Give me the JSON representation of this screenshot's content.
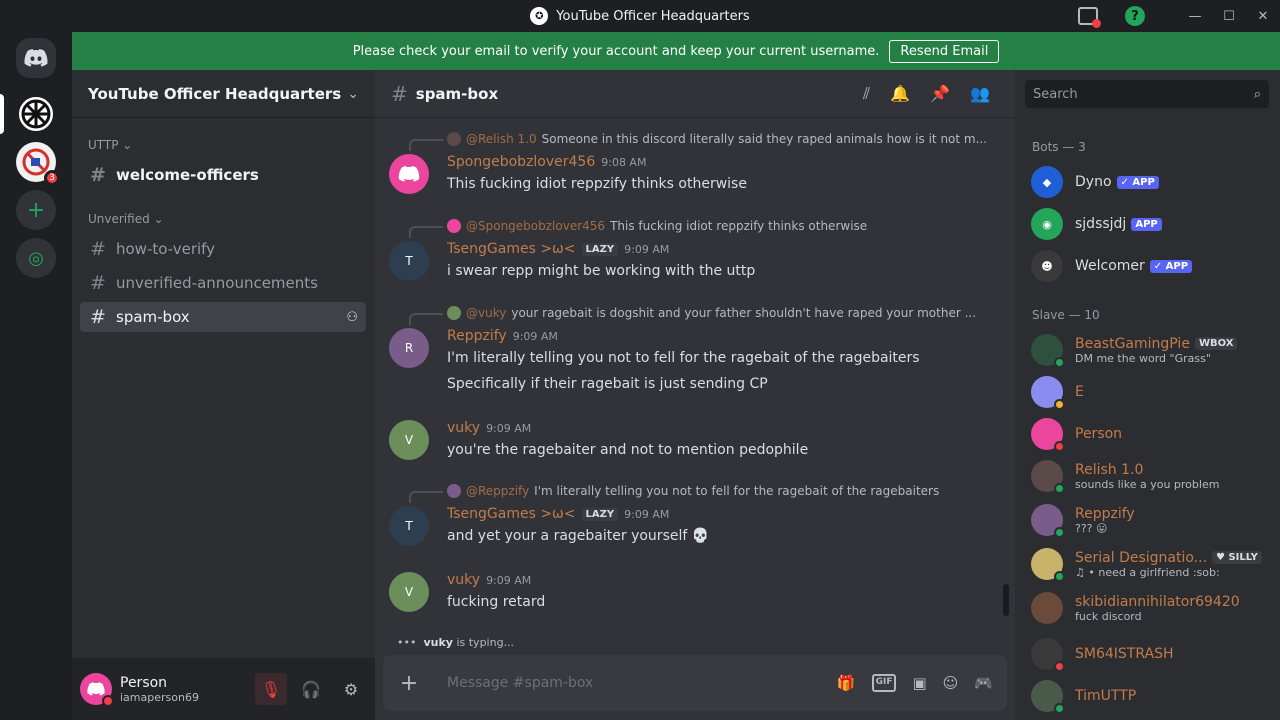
{
  "window": {
    "title": "YouTube Officer Headquarters",
    "controls": [
      "—",
      "☐",
      "✕"
    ]
  },
  "banner": {
    "text": "Please check your email to verify your account and keep your current username.",
    "button": "Resend Email"
  },
  "rail": {
    "badge_count": "3"
  },
  "server": {
    "name": "YouTube Officer Headquarters",
    "categories": [
      {
        "name": "UTTP ⌄",
        "channels": [
          "welcome-officers"
        ]
      },
      {
        "name": "Unverified ⌄",
        "channels": [
          "how-to-verify",
          "unverified-announcements",
          "spam-box"
        ]
      }
    ]
  },
  "user_panel": {
    "display_name": "Person",
    "username": "iamaperson69"
  },
  "chat": {
    "channel": "spam-box",
    "messages": [
      {
        "reply_name": "@Relish 1.0",
        "reply_text": "Someone in this discord literally said they raped animals how is it not m...",
        "author": "Spongebobzlover456",
        "tag": "",
        "time": "9:08 AM",
        "lines": [
          "This fucking idiot reppzify thinks otherwise"
        ],
        "avatar_color": "#eb459e"
      },
      {
        "reply_name": "@Spongebobzlover456",
        "reply_text": "This fucking idiot reppzify thinks otherwise",
        "author": "TsengGames >ω<",
        "tag": "LAZY",
        "time": "9:09 AM",
        "lines": [
          "i swear repp might be working with the uttp"
        ],
        "avatar_color": "#2c3e50"
      },
      {
        "reply_name": "@vuky",
        "reply_text": "your ragebait is dogshit and your father shouldn't have raped your mother ...",
        "author": "Reppzify",
        "tag": "",
        "time": "9:09 AM",
        "lines": [
          "I'm literally telling you not to fell for the ragebait of the ragebaiters",
          "Specifically if their ragebait is just sending CP"
        ],
        "avatar_color": "#7a5c8a"
      },
      {
        "reply_name": "",
        "reply_text": "",
        "author": "vuky",
        "tag": "",
        "time": "9:09 AM",
        "lines": [
          "you're the ragebaiter and not to mention pedophile"
        ],
        "avatar_color": "#6b8e5a"
      },
      {
        "reply_name": "@Reppzify",
        "reply_text": "I'm literally telling you not to fell for the ragebait of the ragebaiters",
        "author": "TsengGames >ω<",
        "tag": "LAZY",
        "time": "9:09 AM",
        "lines": [
          "and yet your a ragebaiter yourself 💀"
        ],
        "avatar_color": "#2c3e50"
      },
      {
        "reply_name": "",
        "reply_text": "",
        "author": "vuky",
        "tag": "",
        "time": "9:09 AM",
        "lines": [
          "fucking retard"
        ],
        "avatar_color": "#6b8e5a"
      }
    ],
    "typing_user": "vuky",
    "typing_suffix": " is typing...",
    "composer_placeholder": "Message #spam-box"
  },
  "members": {
    "search_placeholder": "Search",
    "groups": [
      {
        "label": "Bots — 3",
        "items": [
          {
            "name": "Dyno",
            "tag": "✓ APP",
            "sub": "",
            "color": "#3b82f6",
            "status": ""
          },
          {
            "name": "sjdssjdj",
            "tag": "APP",
            "sub": "",
            "color": "#23a55a",
            "status": ""
          },
          {
            "name": "Welcomer",
            "tag": "✓ APP",
            "sub": "",
            "color": "#3a3a3a",
            "status": ""
          }
        ]
      },
      {
        "label": "Slave — 10",
        "items": [
          {
            "name": "BeastGamingPie",
            "tag": "WBOX",
            "sub": "DM me the word \"Grass\"",
            "color": "#2f4f3f",
            "status": "#23a55a"
          },
          {
            "name": "E",
            "tag": "",
            "sub": "",
            "color": "#8b8cf0",
            "status": "#f0b232"
          },
          {
            "name": "Person",
            "tag": "",
            "sub": "",
            "color": "#eb459e",
            "status": "#f23f43"
          },
          {
            "name": "Relish 1.0",
            "tag": "",
            "sub": "sounds like a you problem",
            "color": "#5a4a4a",
            "status": "#23a55a"
          },
          {
            "name": "Reppzify",
            "tag": "",
            "sub": "??? 😛",
            "color": "#7a5c8a",
            "status": "#23a55a"
          },
          {
            "name": "Serial Designatio...",
            "tag": "♥ SILLY",
            "sub": "♫ • need a girlfriend :sob:",
            "color": "#c9b36b",
            "status": "#23a55a"
          },
          {
            "name": "skibidiannihilator69420",
            "tag": "",
            "sub": "fuck discord",
            "color": "#6a4a3a",
            "status": ""
          },
          {
            "name": "SM64ISTRASH",
            "tag": "",
            "sub": "",
            "color": "#3a3a3a",
            "status": "#f23f43"
          },
          {
            "name": "TimUTTP",
            "tag": "",
            "sub": "",
            "color": "#4a5a4a",
            "status": "#23a55a"
          }
        ]
      }
    ]
  },
  "icons": {
    "discord_home": "discord-icon",
    "add_server": "plus-icon",
    "explore": "compass-icon",
    "threads": "threads-icon",
    "bell": "bell-icon",
    "pin": "pin-icon",
    "members": "members-icon",
    "mic": "mic-muted-icon",
    "headset": "headphones-icon",
    "settings": "gear-icon"
  }
}
